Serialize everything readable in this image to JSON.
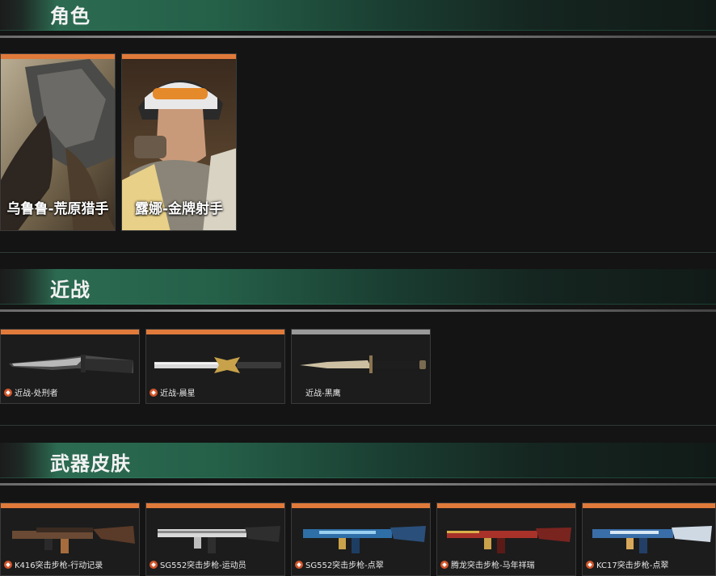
{
  "sections": {
    "characters": {
      "title": "角色"
    },
    "melee": {
      "title": "近战"
    },
    "skins": {
      "title": "武器皮肤"
    }
  },
  "characters": [
    {
      "label": "乌鲁鲁-荒原猎手"
    },
    {
      "label": "露娜-金牌射手"
    }
  ],
  "melee": [
    {
      "label": "近战-处刑者"
    },
    {
      "label": "近战-晨星"
    },
    {
      "label": "近战-黑鹰"
    }
  ],
  "skins": [
    {
      "label": "K416突击步枪-行动记录"
    },
    {
      "label": "SG552突击步枪-运动员"
    },
    {
      "label": "SG552突击步枪-点翠"
    },
    {
      "label": "腾龙突击步枪-马年祥瑞"
    },
    {
      "label": "KC17突击步枪-点翠"
    }
  ],
  "colors": {
    "rarity_orange": "#e07a3a",
    "rarity_grey": "#9a9a9a",
    "header_green": "#2c6b52"
  }
}
